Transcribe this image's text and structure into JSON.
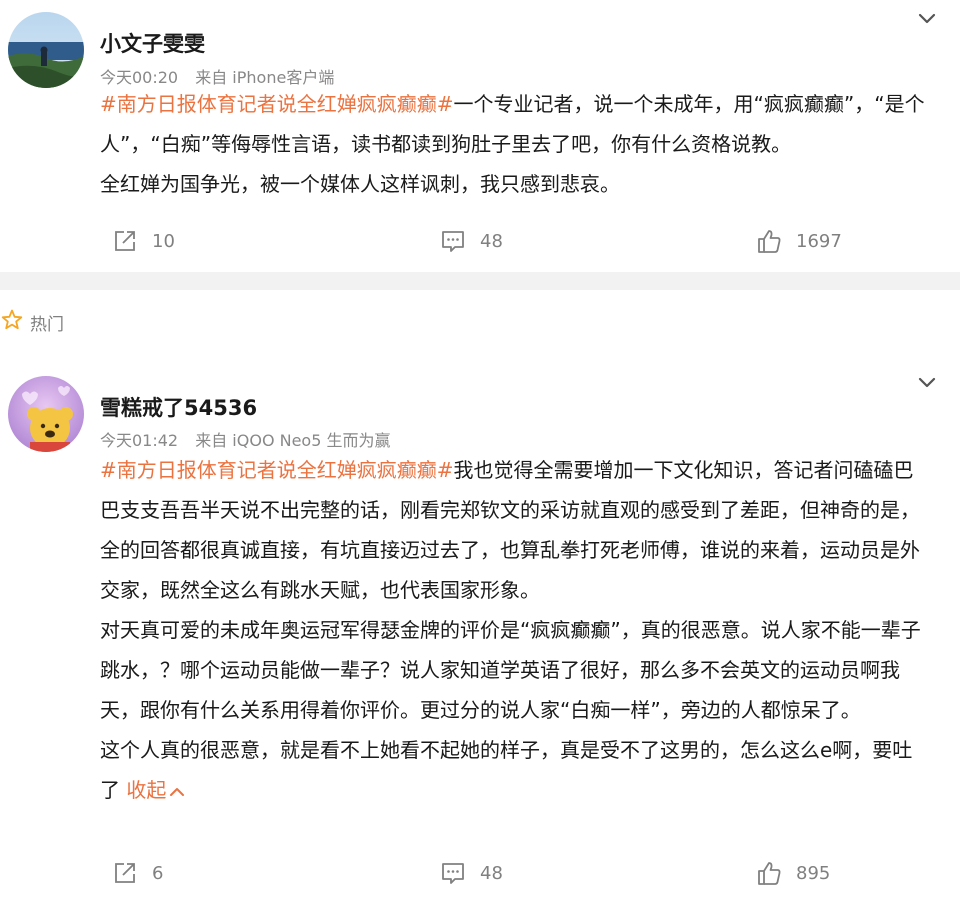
{
  "posts": [
    {
      "username": "小文子雯雯",
      "time": "今天00:20",
      "source": "来自 iPhone客户端",
      "hashtag": "#南方日报体育记者说全红婵疯疯癫癫#",
      "paragraphs": [
        "一个专业记者，说一个未成年，用“疯疯癫癫”，“是个人”，“白痴”等侮辱性言语，读书都读到狗肚子里去了吧，你有什么资格说教。",
        "全红婵为国争光，被一个媒体人这样讽刺，我只感到悲哀。"
      ],
      "reposts": "10",
      "comments": "48",
      "likes": "1697"
    },
    {
      "username": "雪糕戒了54536",
      "time": "今天01:42",
      "source": "来自 iQOO Neo5 生而为赢",
      "hashtag": "#南方日报体育记者说全红婵疯疯癫癫#",
      "paragraphs": [
        "我也觉得全需要增加一下文化知识，答记者问磕磕巴巴支支吾吾半天说不出完整的话，刚看完郑钦文的采访就直观的感受到了差距，但神奇的是，全的回答都很真诚直接，有坑直接迈过去了，也算乱拳打死老师傅，谁说的来着，运动员是外交家，既然全这么有跳水天赋，也代表国家形象。",
        "对天真可爱的未成年奥运冠军得瑟金牌的评价是“疯疯癫癫”，真的很恶意。说人家不能一辈子跳水，？哪个运动员能做一辈子？说人家知道学英语了很好，那么多不会英文的运动员啊我天，跟你有什么关系用得着你评价。更过分的说人家“白痴一样”，旁边的人都惊呆了。",
        "这个人真的很恶意，就是看不上她看不起她的样子，真是受不了这男的，怎么这么e啊，要吐了 "
      ],
      "collapse_label": "收起",
      "reposts": "6",
      "comments": "48",
      "likes": "895"
    }
  ],
  "section": {
    "label": "热门",
    "icon": "star-icon"
  },
  "colors": {
    "accent": "#eb7340",
    "meta": "#888888",
    "divider": "#f2f2f2",
    "icon": "#808080",
    "star": "#f5a623"
  }
}
